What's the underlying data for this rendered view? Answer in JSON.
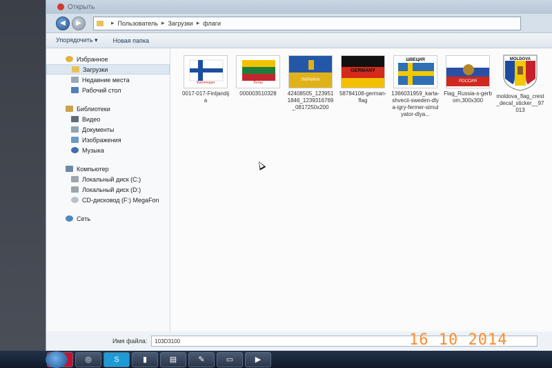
{
  "window": {
    "title": "Открыть"
  },
  "address": {
    "crumbs": [
      "Пользователь",
      "Загрузки",
      "флаги"
    ]
  },
  "toolbar": {
    "organize_label": "Упорядочить ▾",
    "new_folder_label": "Новая папка"
  },
  "nav": {
    "favorites": {
      "label": "Избранное",
      "items": [
        "Загрузки",
        "Недавние места",
        "Рабочий стол"
      ]
    },
    "libraries": {
      "label": "Библиотеки",
      "items": [
        "Видео",
        "Документы",
        "Изображения",
        "Музыка"
      ]
    },
    "computer": {
      "label": "Компьютер",
      "items": [
        "Локальный диск (C:)",
        "Локальный диск (D:)",
        "CD-дисковод (F:) MegaFon"
      ]
    },
    "network": {
      "label": "Сеть"
    }
  },
  "files": [
    {
      "name": "0017-017-Finljandija",
      "thumb_caption": "Финляндия"
    },
    {
      "name": "000003510328",
      "thumb_caption": "Литва"
    },
    {
      "name": "42408505_1239511846_1239316769_0817250x200",
      "thumb_caption": "УКРАИНА"
    },
    {
      "name": "58784108-german-flag",
      "thumb_caption": "GERMANY"
    },
    {
      "name": "1366031959_karta-shvecii-sweden-dlya-igry-fermer-simulyator-dlya...",
      "thumb_caption": "ШВЕЦИЯ"
    },
    {
      "name": "Flag_Russia-s-gerbom,300x300",
      "thumb_caption": "РОССИЯ"
    },
    {
      "name": "moldova_flag_crest_decal_sticker__97013",
      "thumb_caption": "MOLDOVA"
    }
  ],
  "filename": {
    "label": "Имя файла:",
    "value": "103D3100"
  },
  "datestamp": "16 10 2014",
  "colors": {
    "accent": "#2a5c98",
    "datestamp": "#ff8a2a"
  }
}
